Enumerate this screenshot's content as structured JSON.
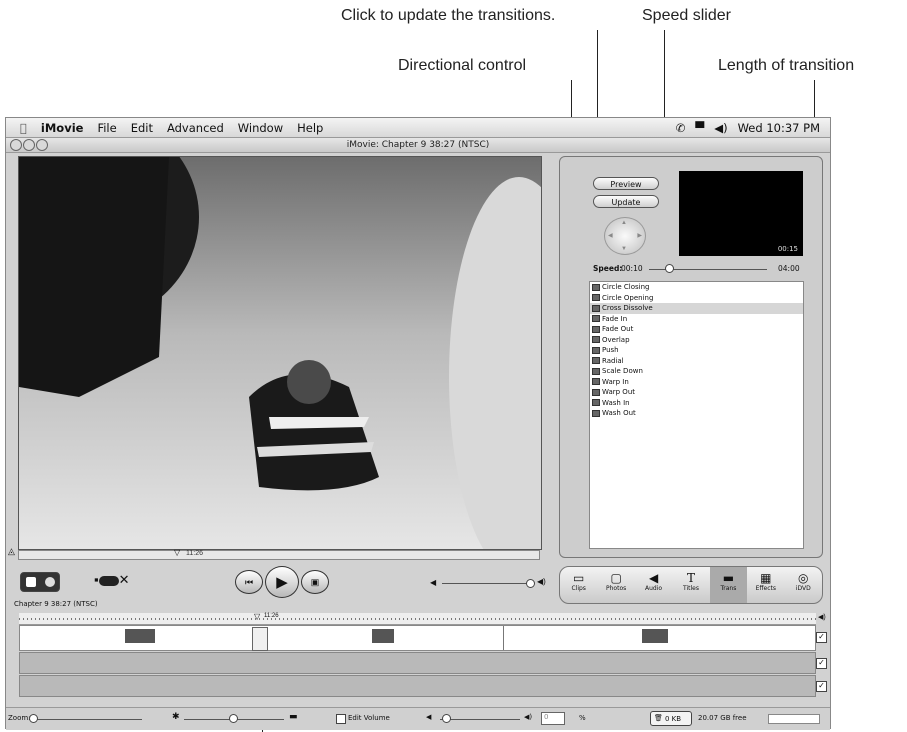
{
  "callouts": {
    "update_transitions": "Click to update the transitions.",
    "speed_slider": "Speed slider",
    "directional_control": "Directional control",
    "length_of_transition": "Length of transition"
  },
  "menubar": {
    "apple": "",
    "app": "iMovie",
    "items": [
      "File",
      "Edit",
      "Advanced",
      "Window",
      "Help"
    ],
    "clock": "Wed 10:37 PM"
  },
  "window": {
    "title": "iMovie: Chapter 9  38:27 (NTSC)"
  },
  "monitor": {
    "playhead_time": "11:26"
  },
  "right_pane": {
    "preview_button": "Preview",
    "update_button": "Update",
    "preview_time": "00:15",
    "speed_label": "Speed:",
    "speed_min": "00:10",
    "speed_max": "04:00",
    "transitions": [
      "Circle Closing",
      "Circle Opening",
      "Cross Dissolve",
      "Fade In",
      "Fade Out",
      "Overlap",
      "Push",
      "Radial",
      "Scale Down",
      "Warp In",
      "Warp Out",
      "Wash In",
      "Wash Out"
    ],
    "selected_transition": "Cross Dissolve"
  },
  "pane_buttons": [
    {
      "label": "Clips",
      "icon": "clips-icon",
      "glyph": "▭"
    },
    {
      "label": "Photos",
      "icon": "photos-icon",
      "glyph": "▢"
    },
    {
      "label": "Audio",
      "icon": "audio-icon",
      "glyph": "◀"
    },
    {
      "label": "Titles",
      "icon": "titles-icon",
      "glyph": "T"
    },
    {
      "label": "Trans",
      "icon": "trans-icon",
      "glyph": "▬"
    },
    {
      "label": "Effects",
      "icon": "effects-icon",
      "glyph": "▦"
    },
    {
      "label": "iDVD",
      "icon": "idvd-icon",
      "glyph": "◎"
    }
  ],
  "active_pane": "Trans",
  "timeline": {
    "chapter_label": "Chapter 9  38:27 (NTSC)",
    "playhead_time": "11:26"
  },
  "bottom_bar": {
    "zoom_label": "Zoom:",
    "edit_volume_label": "Edit Volume",
    "volume_value": "0",
    "volume_unit": "%",
    "trash_size": "0 KB",
    "free_space": "20.07 GB free"
  }
}
